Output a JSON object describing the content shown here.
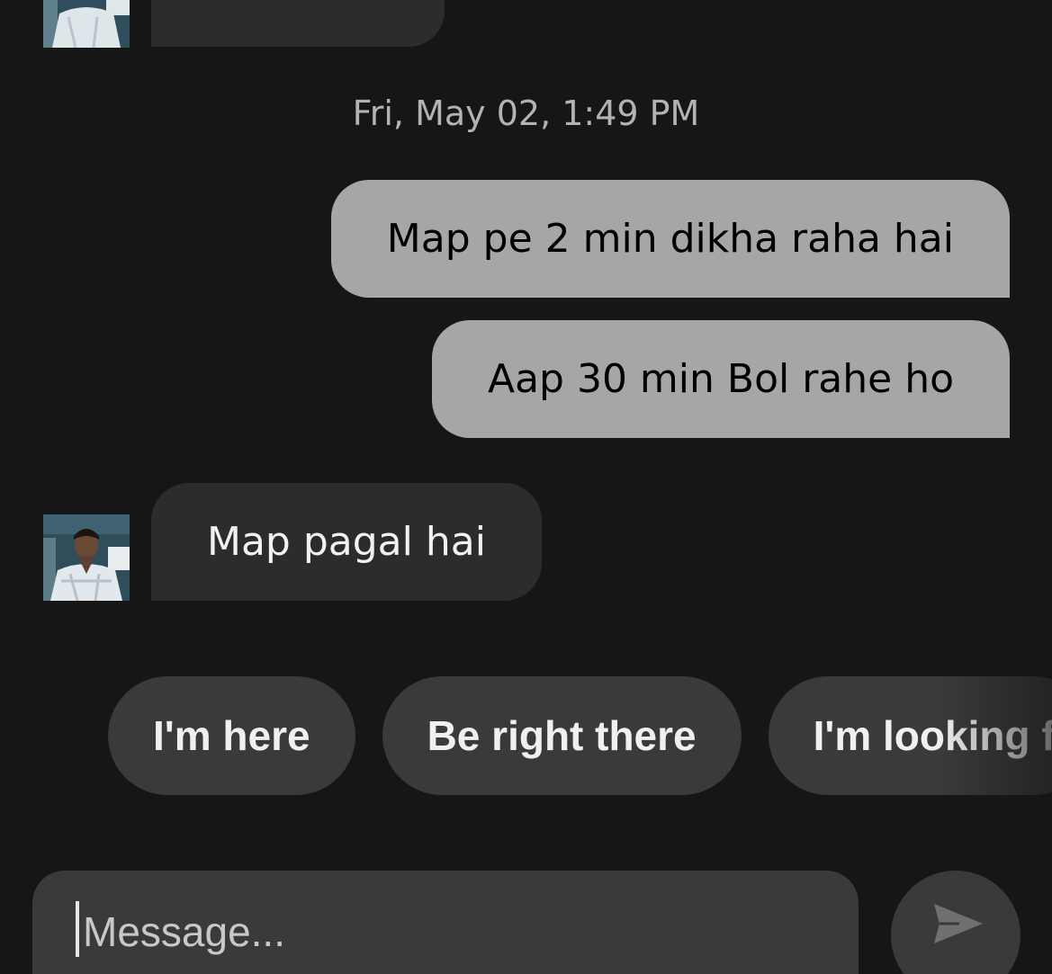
{
  "conversation": {
    "timestamp": "Fri, May 02, 1:49 PM",
    "messages": [
      {
        "direction": "sent",
        "text": "Map pe 2 min dikha raha hai"
      },
      {
        "direction": "sent",
        "text": "Aap 30 min Bol rahe ho"
      },
      {
        "direction": "received",
        "text": "Map pagal hai"
      }
    ]
  },
  "quick_replies": [
    "I'm here",
    "Be right there",
    "I'm looking f"
  ],
  "composer": {
    "placeholder": "Message...",
    "value": ""
  },
  "colors": {
    "background": "#161616",
    "sent_bubble": "#a6a6a6",
    "received_bubble": "#2c2c2c",
    "chip": "#3a3a3a"
  },
  "icons": {
    "send": "send-arrow-icon",
    "avatar": "driver-avatar"
  }
}
